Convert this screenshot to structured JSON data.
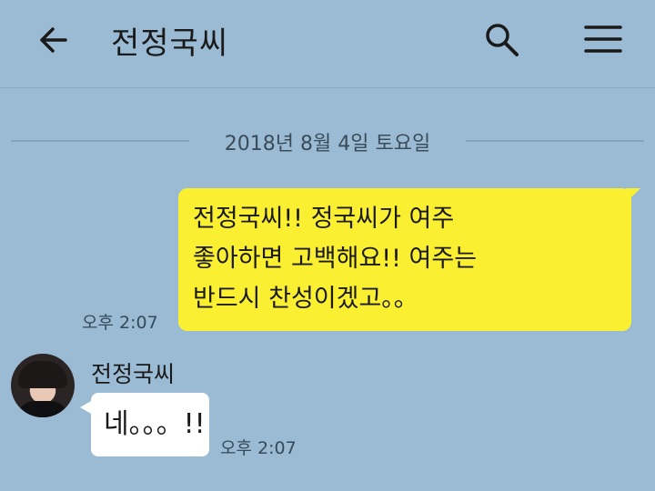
{
  "header": {
    "title": "전정국씨",
    "back_icon": "arrow-left-icon",
    "search_icon": "search-icon",
    "menu_icon": "hamburger-menu-icon"
  },
  "date_separator": "2018년 8월 4일 토요일",
  "messages": [
    {
      "from": "me",
      "lines": [
        "전정국씨!! 정국씨가 여주",
        "좋아하면 고백해요!! 여주는",
        "반드시 찬성이겠고。。"
      ],
      "time": "오후 2:07",
      "bubble_color": "#fbef31"
    },
    {
      "from": "them",
      "sender": "전정국씨",
      "text": "네。。。!!",
      "time": "오후 2:07",
      "bubble_color": "#ffffff"
    }
  ],
  "colors": {
    "background": "#9bbbd4",
    "my_bubble": "#fbef31",
    "their_bubble": "#ffffff"
  }
}
